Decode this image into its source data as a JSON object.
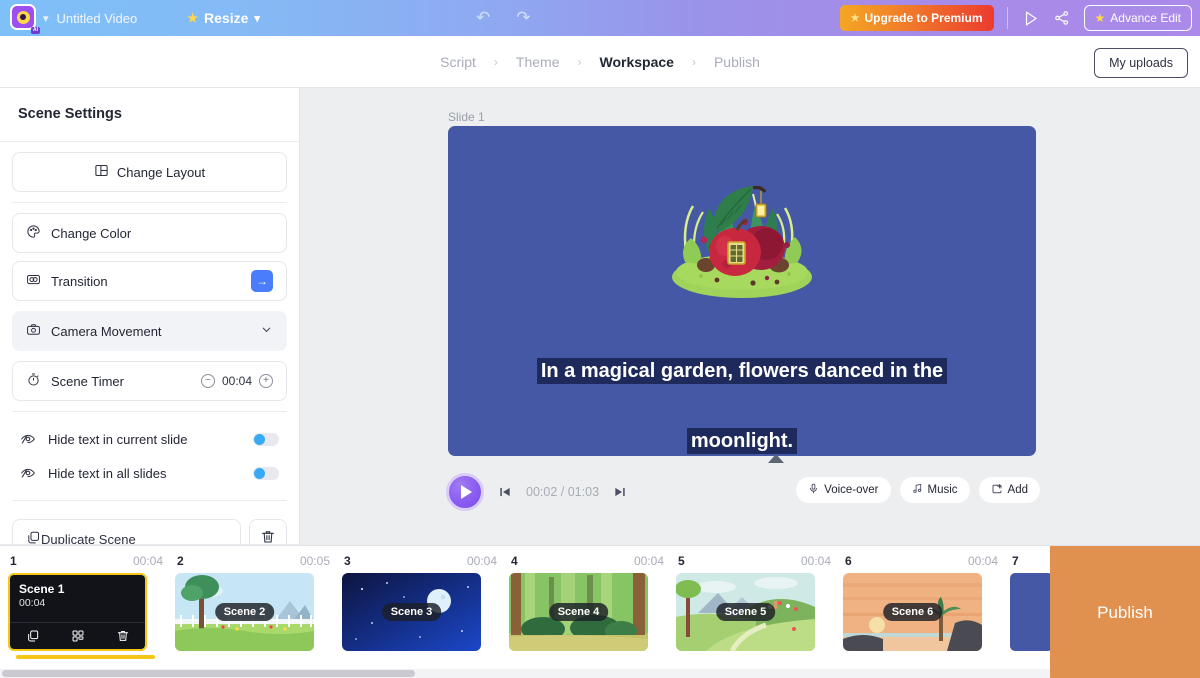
{
  "topbar": {
    "logo_badge": "AI",
    "project_title": "Untitled Video",
    "resize_label": "Resize",
    "undo_icon": "undo-icon",
    "redo_icon": "redo-icon",
    "upgrade_label": "Upgrade to Premium",
    "preview_icon": "play-outline-icon",
    "share_icon": "share-icon",
    "advance_edit_label": "Advance Edit",
    "gradient_start": "#7ec0f8",
    "gradient_end": "#ab8ae9"
  },
  "breadcrumb": {
    "separator": "›",
    "items": [
      {
        "label": "Script",
        "active": false
      },
      {
        "label": "Theme",
        "active": false
      },
      {
        "label": "Workspace",
        "active": true
      },
      {
        "label": "Publish",
        "active": false
      }
    ],
    "my_uploads_label": "My uploads"
  },
  "left_panel": {
    "title": "Scene Settings",
    "change_layout_label": "Change Layout",
    "change_color_label": "Change Color",
    "transition_label": "Transition",
    "transition_arrow": "→",
    "camera_movement_label": "Camera Movement",
    "camera_chevron": "⌄",
    "scene_timer_label": "Scene Timer",
    "scene_timer_value": "00:04",
    "timer_minus": "−",
    "timer_plus": "+",
    "hide_text_current_label": "Hide text in current slide",
    "hide_text_all_label": "Hide text in all slides",
    "duplicate_scene_label": "Duplicate Scene",
    "delete_icon": "trash-icon"
  },
  "canvas": {
    "slide_label": "Slide 1",
    "slide_background": "#4458a6",
    "caption_lines": [
      "In a magical garden, flowers danced in the",
      "moonlight."
    ],
    "caption_bg": "#1f2a5c",
    "player": {
      "play_icon": "play-icon",
      "prev_icon": "skip-previous-icon",
      "next_icon": "skip-next-icon",
      "current_time": "00:02",
      "separator": "/",
      "total_time": "01:03"
    },
    "actions": [
      {
        "label": "Voice-over",
        "icon": "microphone-icon"
      },
      {
        "label": "Music",
        "icon": "music-note-icon"
      },
      {
        "label": "Add",
        "icon": "add-frame-icon"
      }
    ]
  },
  "timeline": {
    "scenes": [
      {
        "num": "1",
        "duration": "00:04",
        "name": "Scene 1",
        "time": "00:04",
        "selected": true
      },
      {
        "num": "2",
        "duration": "00:05",
        "name": "Scene 2",
        "selected": false
      },
      {
        "num": "3",
        "duration": "00:04",
        "name": "Scene 3",
        "selected": false
      },
      {
        "num": "4",
        "duration": "00:04",
        "name": "Scene 4",
        "selected": false
      },
      {
        "num": "5",
        "duration": "00:04",
        "name": "Scene 5",
        "selected": false
      },
      {
        "num": "6",
        "duration": "00:04",
        "name": "Scene 6",
        "selected": false
      },
      {
        "num": "7",
        "duration": "",
        "name": "",
        "selected": false
      }
    ],
    "selected_icons": [
      "duplicate-icon",
      "layout-icon",
      "trash-icon"
    ],
    "publish_label": "Publish",
    "publish_color": "#e0914f",
    "selection_color": "#f5c518"
  }
}
